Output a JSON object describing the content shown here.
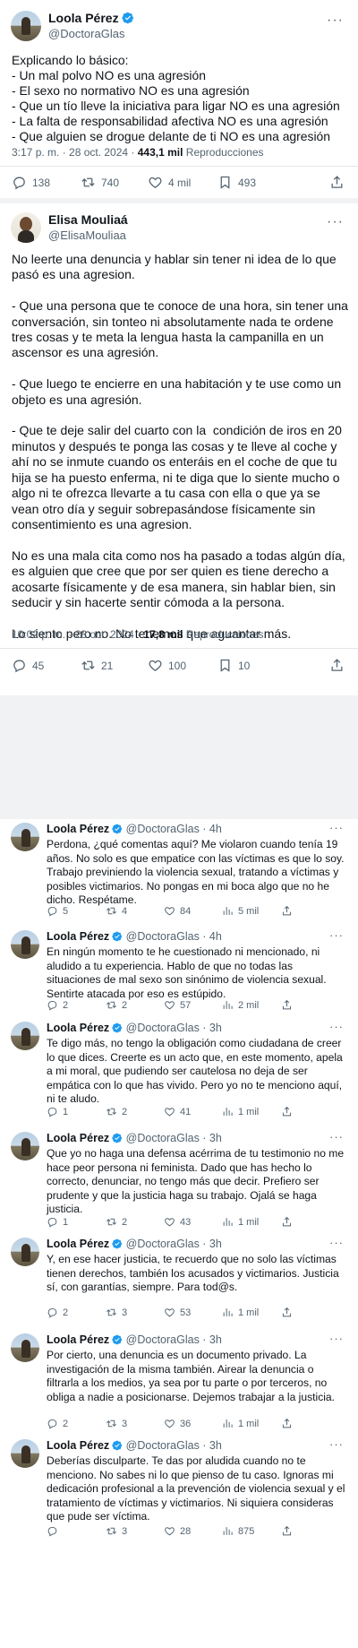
{
  "tweet1": {
    "name": "Loola Pérez",
    "handle": "@DoctoraGlas",
    "text": "Explicando lo básico:\n- Un mal polvo NO es una agresión\n- El sexo no normativo NO es una agresión\n- Que un tío lleve la iniciativa para ligar NO es una agresión\n- La falta de responsabilidad afectiva NO es una agresión\n- Que alguien se drogue delante de ti NO es una agresión",
    "time": "3:17 p. m. · 28 oct. 2024 · ",
    "views_count": "443,1 mil",
    "views_label": " Reproducciones",
    "replies": "138",
    "retweets": "740",
    "likes": "4 mil",
    "bookmarks": "493"
  },
  "tweet2": {
    "name": "Elisa Mouliaá",
    "handle": "@ElisaMouliaa",
    "text": "No leerte una denuncia y hablar sin tener ni idea de lo que pasó es una agresion.\n\n- Que una persona que te conoce de una hora, sin tener una conversación, sin tonteo ni absolutamente nada te ordene tres cosas y te meta la lengua hasta la campanilla en un ascensor es una agresión.\n\n- Que luego te encierre en una habitación y te use como un objeto es una agresión.\n\n- Que te deje salir del cuarto con la  condición de iros en 20 minutos y después te ponga las cosas y te lleve al coche y ahí no se inmute cuando os enteráis en el coche de que tu hija se ha puesto enferma, ni te diga que lo siente mucho o algo ni te ofrezca llevarte a tu casa con ella o que ya se vean otro día y seguir sobrepasándose físicamente sin consentimiento es una agresion.\n\nNo es una mala cita como nos ha pasado a todas algún día, es alguien que cree que por ser quien es tiene derecho a acosarte físicamente y de esa manera, sin hablar bien, sin seducir y sin hacerte sentir cómoda a la persona.\n\nLo siento pero no. No tenemos que aguantar más.",
    "time": "10:02 p. m. · 28 oct. 2024 · ",
    "views_count": "17,8 mil",
    "views_label": " Reproducciones",
    "replies": "45",
    "retweets": "21",
    "likes": "100",
    "bookmarks": "10"
  },
  "replies": [
    {
      "name": "Loola Pérez",
      "handle": "@DoctoraGlas · 4h",
      "text": "Perdona, ¿qué comentas aquí? Me violaron cuando tenía 19 años. No solo es que empatice con las víctimas es que lo soy. Trabajo previniendo la violencia sexual, tratando a víctimas y posibles victimarios. No pongas en mi boca algo que no he dicho. Respétame.",
      "replies": "5",
      "retweets": "4",
      "likes": "84",
      "views": "5 mil"
    },
    {
      "name": "Loola Pérez",
      "handle": "@DoctoraGlas · 4h",
      "text": "En ningún momento te he cuestionado ni mencionado, ni aludido a tu experiencia. Hablo de que no todas las situaciones de mal sexo son sinónimo de violencia sexual. Sentirte atacada por eso es estúpido.",
      "replies": "2",
      "retweets": "2",
      "likes": "57",
      "views": "2 mil"
    },
    {
      "name": "Loola Pérez",
      "handle": "@DoctoraGlas · 3h",
      "text": "Te digo más, no tengo la obligación como ciudadana de creer lo que dices. Creerte es un acto que, en este momento, apela a mi moral, que pudiendo ser cautelosa no deja de ser empática con lo que has vivido. Pero yo no te menciono aquí, ni te aludo.",
      "replies": "1",
      "retweets": "2",
      "likes": "41",
      "views": "1 mil"
    },
    {
      "name": "Loola Pérez",
      "handle": "@DoctoraGlas · 3h",
      "text": "Que yo no haga una defensa acérrima de tu testimonio no me hace peor persona ni feminista. Dado que has hecho lo correcto, denunciar, no tengo más que decir. Prefiero ser prudente y que la justicia haga su trabajo. Ojalá se haga justicia.",
      "replies": "1",
      "retweets": "2",
      "likes": "43",
      "views": "1 mil"
    },
    {
      "name": "Loola Pérez",
      "handle": "@DoctoraGlas · 3h",
      "text": "Y, en ese hacer justicia, te recuerdo que no solo las víctimas tienen derechos, también los acusados y victimarios. Justicia sí, con garantías, siempre. Para tod@s.",
      "replies": "2",
      "retweets": "3",
      "likes": "53",
      "views": "1 mil"
    },
    {
      "name": "Loola Pérez",
      "handle": "@DoctoraGlas · 3h",
      "text": "Por cierto, una denuncia es un documento privado. La investigación de la misma también. Airear la denuncia o filtrarla a los medios, ya sea por tu parte o por terceros, no obliga a nadie a posicionarse. Dejemos trabajar a la justicia.",
      "replies": "2",
      "retweets": "3",
      "likes": "36",
      "views": "1 mil"
    },
    {
      "name": "Loola Pérez",
      "handle": "@DoctoraGlas · 3h",
      "text": "Deberías disculparte. Te das por aludida cuando no te menciono. No sabes ni lo que pienso de tu caso. Ignoras mi dedicación profesional a la prevención de violencia sexual y el tratamiento de víctimas y victimarios. Ni siquiera consideras que pude ser víctima.",
      "replies": "",
      "retweets": "3",
      "likes": "28",
      "views": "875"
    }
  ],
  "icons": {
    "more": "···"
  },
  "colors": {
    "verified": "#1d9bf0",
    "muted": "#536471",
    "text": "#0f1419"
  }
}
